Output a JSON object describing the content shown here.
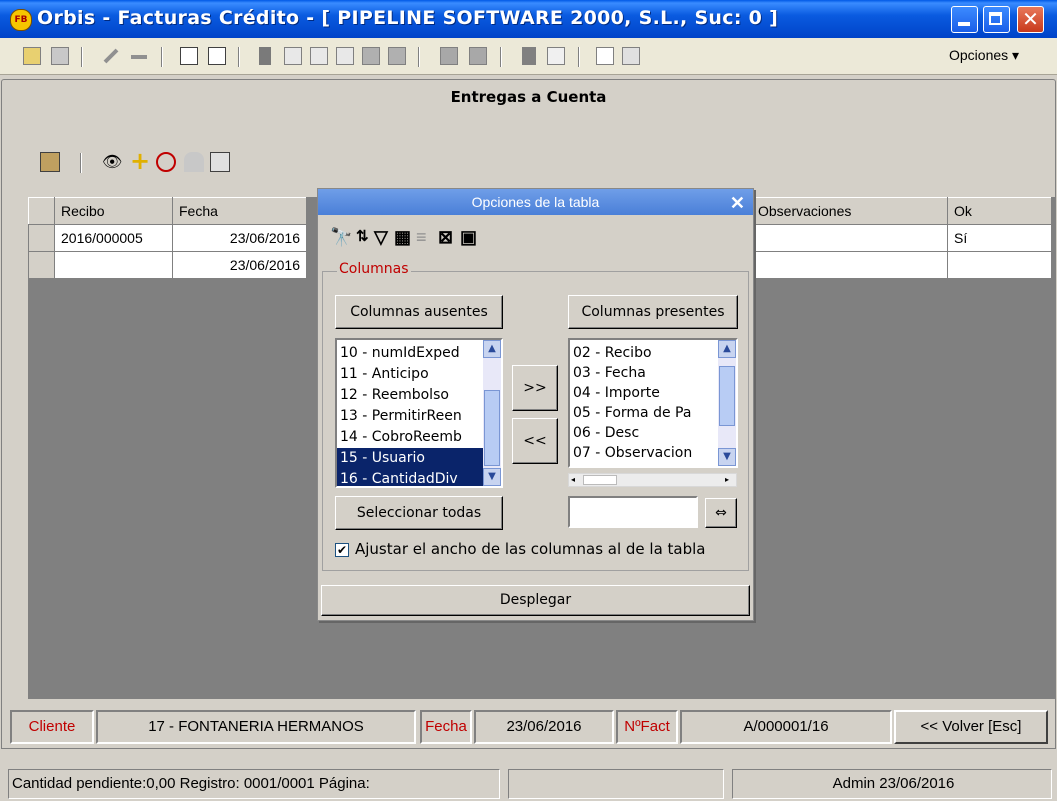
{
  "window": {
    "title": "Orbis - Facturas Crédito - [ PIPELINE SOFTWARE 2000, S.L.,  Suc: 0 ]",
    "logo_text": "FB"
  },
  "toolbar": {
    "options_label": "Opciones ▾"
  },
  "panel": {
    "title": "Entregas a Cuenta"
  },
  "grid": {
    "columns": [
      "Recibo",
      "Fecha",
      "Observaciones",
      "Ok"
    ],
    "rows": [
      {
        "recibo": "2016/000005",
        "fecha": "23/06/2016",
        "observaciones": "",
        "ok": "Sí"
      },
      {
        "recibo": "",
        "fecha": "23/06/2016",
        "observaciones": "",
        "ok": ""
      }
    ]
  },
  "dialog": {
    "title": "Opciones de la tabla",
    "close": "✕",
    "group_label": "Columnas",
    "absent_label": "Columnas ausentes",
    "present_label": "Columnas presentes",
    "absent_items": [
      "10 - numIdExped",
      "11 - Anticipo",
      "12 - Reembolso",
      "13 - PermitirReen",
      "14 - CobroReemb",
      "15 - Usuario",
      "16 - CantidadDiv"
    ],
    "present_items": [
      "02 - Recibo",
      "03 - Fecha",
      "04 - Importe",
      "05 - Forma de Pa",
      "06 - Desc",
      "07 - Observacion"
    ],
    "add_btn": ">>",
    "remove_btn": "<<",
    "select_all": "Seleccionar todas",
    "adjust_label": "Ajustar el ancho de las columnas al de la tabla",
    "adjust_checked": true,
    "expand_btn": "Desplegar"
  },
  "infobar": {
    "client_label": "Cliente",
    "client_value": "17 - FONTANERIA HERMANOS",
    "date_label": "Fecha",
    "date_value": "23/06/2016",
    "invoice_label": "NºFact",
    "invoice_value": "A/000001/16",
    "back_btn": "<< Volver  [Esc]"
  },
  "statusbar": {
    "left": "Cantidad pendiente:0,00 Registro: 0001/0001  Página:",
    "middle": "",
    "right": "Admin 23/06/2016"
  }
}
